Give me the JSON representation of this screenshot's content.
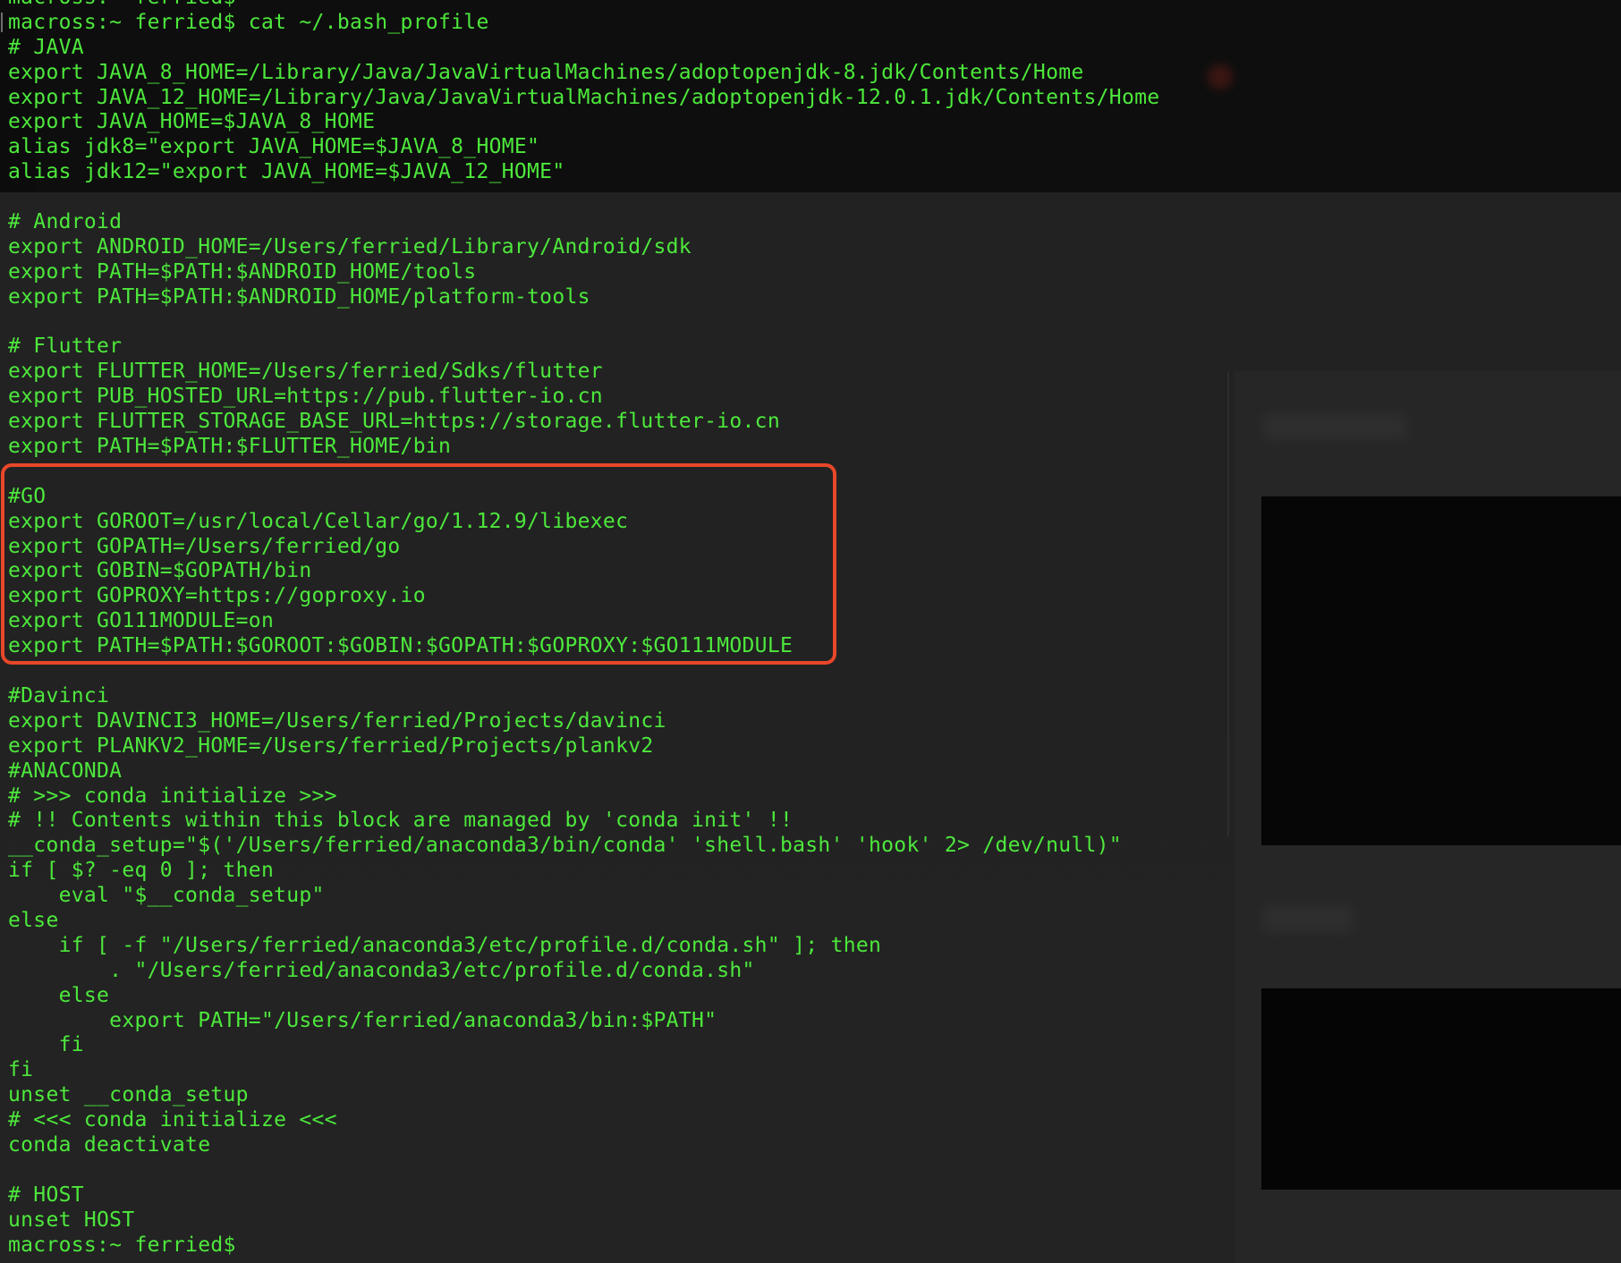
{
  "terminal": {
    "lines": [
      "macross:~ ferried$",
      "macross:~ ferried$ cat ~/.bash_profile",
      "# JAVA",
      "export JAVA_8_HOME=/Library/Java/JavaVirtualMachines/adoptopenjdk-8.jdk/Contents/Home",
      "export JAVA_12_HOME=/Library/Java/JavaVirtualMachines/adoptopenjdk-12.0.1.jdk/Contents/Home",
      "export JAVA_HOME=$JAVA_8_HOME",
      "alias jdk8=\"export JAVA_HOME=$JAVA_8_HOME\"",
      "alias jdk12=\"export JAVA_HOME=$JAVA_12_HOME\"",
      "",
      "# Android",
      "export ANDROID_HOME=/Users/ferried/Library/Android/sdk",
      "export PATH=$PATH:$ANDROID_HOME/tools",
      "export PATH=$PATH:$ANDROID_HOME/platform-tools",
      "",
      "# Flutter",
      "export FLUTTER_HOME=/Users/ferried/Sdks/flutter",
      "export PUB_HOSTED_URL=https://pub.flutter-io.cn",
      "export FLUTTER_STORAGE_BASE_URL=https://storage.flutter-io.cn",
      "export PATH=$PATH:$FLUTTER_HOME/bin",
      "",
      "#GO",
      "export GOROOT=/usr/local/Cellar/go/1.12.9/libexec",
      "export GOPATH=/Users/ferried/go",
      "export GOBIN=$GOPATH/bin",
      "export GOPROXY=https://goproxy.io",
      "export GO111MODULE=on",
      "export PATH=$PATH:$GOROOT:$GOBIN:$GOPATH:$GOPROXY:$GO111MODULE",
      "",
      "#Davinci",
      "export DAVINCI3_HOME=/Users/ferried/Projects/davinci",
      "export PLANKV2_HOME=/Users/ferried/Projects/plankv2",
      "#ANACONDA",
      "# >>> conda initialize >>>",
      "# !! Contents within this block are managed by 'conda init' !!",
      "__conda_setup=\"$('/Users/ferried/anaconda3/bin/conda' 'shell.bash' 'hook' 2> /dev/null)\"",
      "if [ $? -eq 0 ]; then",
      "    eval \"$__conda_setup\"",
      "else",
      "    if [ -f \"/Users/ferried/anaconda3/etc/profile.d/conda.sh\" ]; then",
      "        . \"/Users/ferried/anaconda3/etc/profile.d/conda.sh\"",
      "    else",
      "        export PATH=\"/Users/ferried/anaconda3/bin:$PATH\"",
      "    fi",
      "fi",
      "unset __conda_setup",
      "# <<< conda initialize <<<",
      "conda deactivate",
      "",
      "# HOST",
      "unset HOST",
      "macross:~ ferried$"
    ]
  },
  "colors": {
    "terminal_text": "#4de83c",
    "highlight_border": "#e8472a",
    "background": "#141414"
  }
}
